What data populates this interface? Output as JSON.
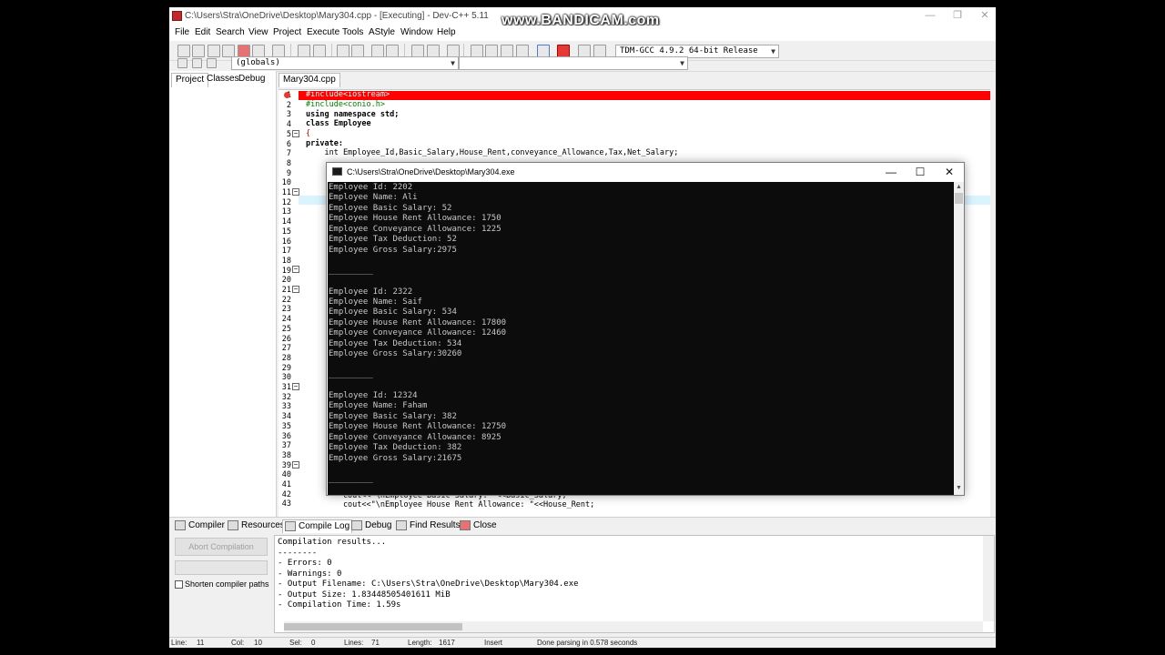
{
  "window": {
    "title": "C:\\Users\\Stra\\OneDrive\\Desktop\\Mary304.cpp - [Executing] - Dev-C++ 5.11",
    "watermark": "www.BANDICAM.com"
  },
  "menu": [
    "File",
    "Edit",
    "Search",
    "View",
    "Project",
    "Execute",
    "Tools",
    "AStyle",
    "Window",
    "Help"
  ],
  "toolbar": {
    "compiler_select": "TDM-GCC 4.9.2 64-bit Release",
    "scope_select": "(globals)",
    "member_select": ""
  },
  "left_panel": {
    "tabs": [
      "Project",
      "Classes",
      "Debug"
    ]
  },
  "editor": {
    "file_tab": "Mary304.cpp",
    "line_numbers": [
      "1",
      "2",
      "3",
      "4",
      "5",
      "6",
      "7",
      "8",
      "9",
      "10",
      "11",
      "12",
      "13",
      "14",
      "15",
      "16",
      "17",
      "18",
      "19",
      "20",
      "21",
      "22",
      "23",
      "24",
      "25",
      "26",
      "27",
      "28",
      "29",
      "30",
      "31",
      "32",
      "33",
      "34",
      "35",
      "36",
      "37",
      "38",
      "39",
      "40",
      "41",
      "42",
      "43"
    ],
    "code": {
      "l1": "#include<iostream>",
      "l2": "#include<conio.h>",
      "l3": "using namespace std;",
      "l4": "class Employee",
      "l5": "{",
      "l6": "private:",
      "l7": "    int Employee_Id,Basic_Salary,House_Rent,conveyance_Allowance,Tax,Net_Salary;",
      "l42": "        cout<<\"\\nEmployee Basic Salary: \"<<Basic_Salary;",
      "l43": "        cout<<\"\\nEmployee House Rent Allowance: \"<<House_Rent;"
    }
  },
  "console": {
    "title": "C:\\Users\\Stra\\OneDrive\\Desktop\\Mary304.exe",
    "lines": [
      "Employee Id: 2202",
      "Employee Name: Ali",
      "Employee Basic Salary: 52",
      "Employee House Rent Allowance: 1750",
      "Employee Conveyance Allowance: 1225",
      "Employee Tax Deduction: 52",
      "Employee Gross Salary:2975",
      "",
      "_________",
      "",
      "Employee Id: 2322",
      "Employee Name: Saif",
      "Employee Basic Salary: 534",
      "Employee House Rent Allowance: 17800",
      "Employee Conveyance Allowance: 12460",
      "Employee Tax Deduction: 534",
      "Employee Gross Salary:30260",
      "",
      "_________",
      "",
      "Employee Id: 12324",
      "Employee Name: Faham",
      "Employee Basic Salary: 382",
      "Employee House Rent Allowance: 12750",
      "Employee Conveyance Allowance: 8925",
      "Employee Tax Deduction: 382",
      "Employee Gross Salary:21675",
      "",
      "_________",
      "",
      "_________"
    ]
  },
  "bottom_tabs": [
    "Compiler",
    "Resources",
    "Compile Log",
    "Debug",
    "Find Results",
    "Close"
  ],
  "compile_panel": {
    "abort_label": "Abort Compilation",
    "shorten_label": "Shorten compiler paths",
    "log": [
      "Compilation results...",
      "--------",
      "- Errors: 0",
      "- Warnings: 0",
      "- Output Filename: C:\\Users\\Stra\\OneDrive\\Desktop\\Mary304.exe",
      "- Output Size: 1.83448505401611 MiB",
      "- Compilation Time: 1.59s"
    ]
  },
  "status_bar": {
    "line": "Line:",
    "line_val": "11",
    "col": "Col:",
    "col_val": "10",
    "sel": "Sel:",
    "sel_val": "0",
    "lines": "Lines:",
    "lines_val": "71",
    "length": "Length:",
    "length_val": "1617",
    "mode": "Insert",
    "message": "Done parsing in 0.578 seconds"
  }
}
